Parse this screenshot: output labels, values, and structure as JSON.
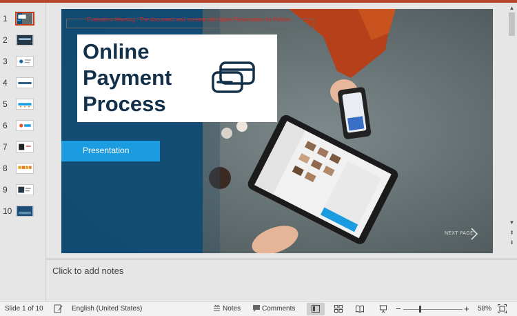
{
  "thumbnails": [
    {
      "number": "1",
      "active": true
    },
    {
      "number": "2",
      "active": false
    },
    {
      "number": "3",
      "active": false
    },
    {
      "number": "4",
      "active": false
    },
    {
      "number": "5",
      "active": false
    },
    {
      "number": "6",
      "active": false
    },
    {
      "number": "7",
      "active": false
    },
    {
      "number": "8",
      "active": false
    },
    {
      "number": "9",
      "active": false
    },
    {
      "number": "10",
      "active": false
    }
  ],
  "slide": {
    "title": "Online Payment Process",
    "button_label": "Presentation",
    "watermark": "Evaluation Warning : The document was created with Spire.Presentation for Python",
    "next_page": "NEXT PAGE",
    "icon": "credit-card-icon",
    "colors": {
      "panel": "#0f4a73",
      "accent": "#1b9ce0",
      "title": "#13304a"
    }
  },
  "notes": {
    "placeholder": "Click to add notes"
  },
  "status": {
    "slide_info": "Slide 1 of 10",
    "language": "English (United States)",
    "notes_label": "Notes",
    "comments_label": "Comments",
    "zoom_minus": "−",
    "zoom_plus": "+",
    "zoom": "58%",
    "zoom_level_fraction": 0.58
  },
  "theme": {
    "app_accent": "#b7472a"
  }
}
